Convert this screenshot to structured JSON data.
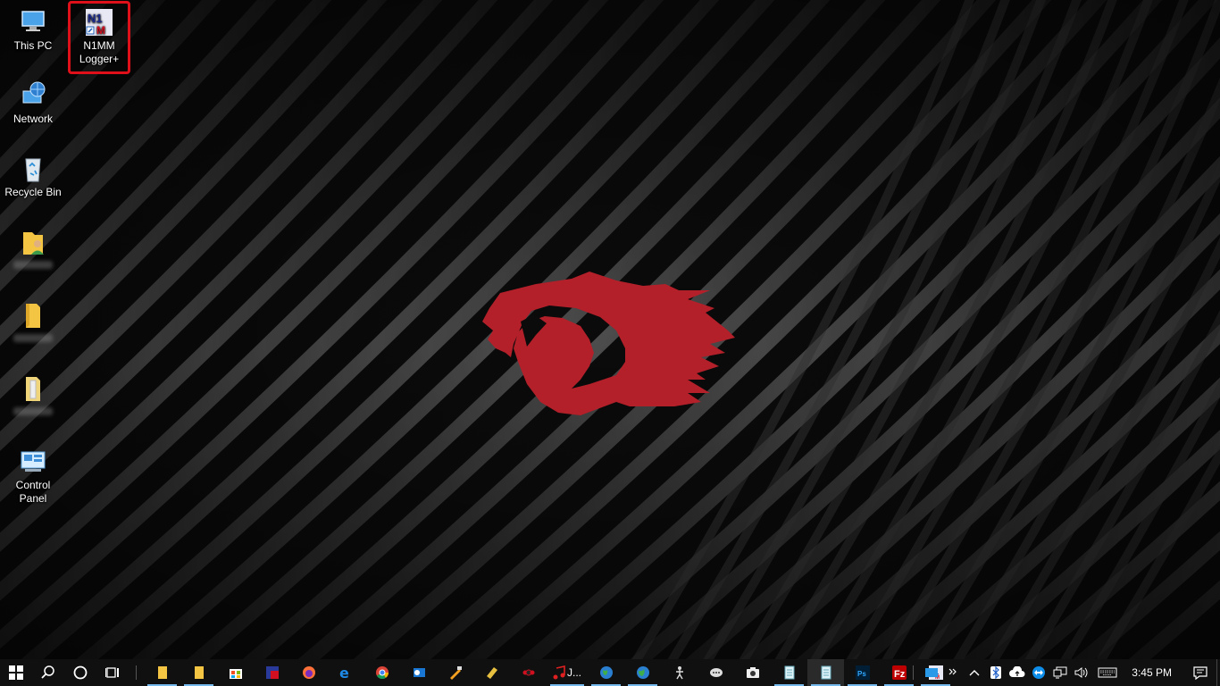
{
  "desktop": {
    "icons": [
      {
        "label": "This PC",
        "icon": "computer-icon"
      },
      {
        "label": "N1MM\nLogger+",
        "label_line1": "N1MM",
        "label_line2": "Logger+",
        "icon": "n1mm-logger-icon"
      },
      {
        "label": "Network",
        "icon": "network-icon"
      },
      {
        "label": "Recycle Bin",
        "icon": "recycle-bin-icon"
      },
      {
        "label": "",
        "icon": "user-folder-icon"
      },
      {
        "label": "",
        "icon": "folder-icon"
      },
      {
        "label": "",
        "icon": "zip-folder-icon"
      },
      {
        "label_line1": "Control",
        "label_line2": "Panel",
        "icon": "control-panel-icon"
      }
    ]
  },
  "taskbar": {
    "apps": [
      "file-explorer-icon",
      "file-explorer-icon",
      "store-icon",
      "app-icon",
      "firefox-icon",
      "edge-icon",
      "chrome-icon",
      "outlook-icon",
      "tool-icon",
      "tool-icon",
      "app-icon",
      "music-icon",
      "globe-icon",
      "globe-icon",
      "app-icon",
      "chat-icon",
      "camera-icon",
      "notepad-icon",
      "notepad-icon",
      "photoshop-icon",
      "filezilla-icon",
      "n1mm-icon"
    ],
    "music_label": "J...",
    "clock": "3:45 PM",
    "colors": {
      "taskbar": "#101010",
      "accent": "#76b9ed",
      "highlight": "#e0101a",
      "logo": "#b4202a"
    }
  }
}
